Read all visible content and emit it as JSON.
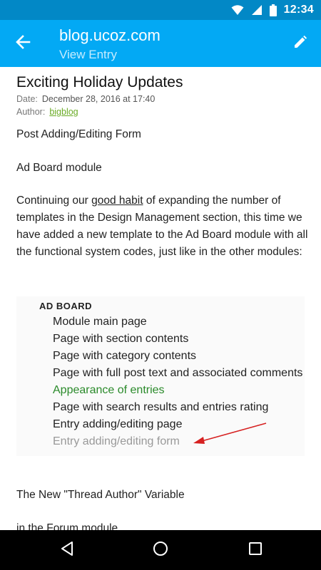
{
  "status_bar": {
    "time": "12:34",
    "icons": [
      "wifi-icon",
      "signal-icon",
      "battery-icon"
    ]
  },
  "app_bar": {
    "title": "blog.ucoz.com",
    "subtitle": "View Entry",
    "icons": {
      "back": "arrow-left-icon",
      "edit": "pencil-icon"
    }
  },
  "entry": {
    "title": "Exciting Holiday Updates",
    "date_label": "Date:",
    "date_value": "December 28, 2016 at 17:40",
    "author_label": "Author:",
    "author_value": "bigblog",
    "paragraphs": {
      "p1": "Post Adding/Editing Form",
      "p2": "Ad Board module",
      "p3_before": "Continuing our ",
      "p3_link": "good habit",
      "p3_after": " of expanding the number of templates in the Design Management section, this time we have added a new template to the Ad Board module with all the functional system codes, just like in the other modules:",
      "p4": "The New \"Thread Author\" Variable",
      "p5": "in the Forum module"
    },
    "board": {
      "title": "AD BOARD",
      "items": [
        "Module main page",
        "Page with section contents",
        "Page with category contents",
        "Page with full post text and associated comments",
        "Appearance of entries",
        "Page with search results and entries rating",
        "Entry adding/editing page",
        "Entry adding/editing form"
      ]
    }
  },
  "nav_bar": {
    "icons": [
      "back-triangle-icon",
      "home-circle-icon",
      "recents-square-icon"
    ]
  },
  "colors": {
    "status_bar": "#0288c6",
    "app_bar": "#03a9f4",
    "link_green": "#6aab25",
    "highlight_green": "#2a8a2a",
    "arrow_red": "#d62020"
  }
}
